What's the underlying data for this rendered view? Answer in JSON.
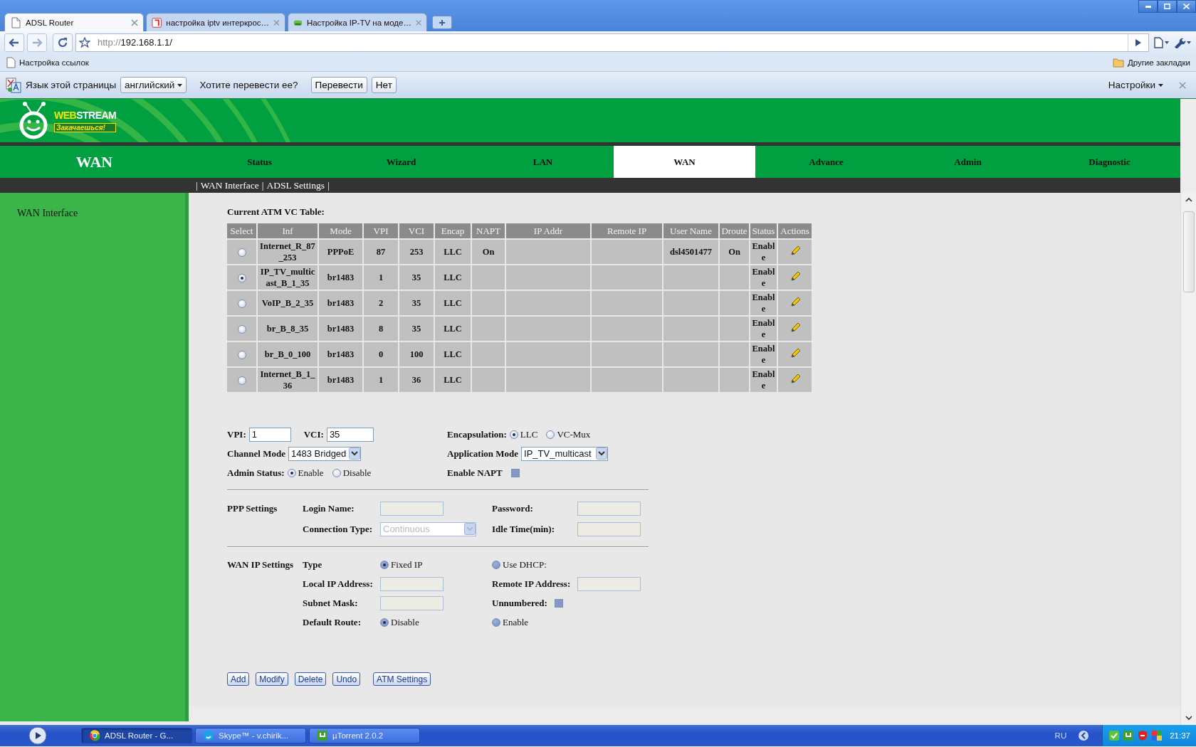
{
  "browser": {
    "tabs": [
      {
        "title": "ADSL Router",
        "selected": true
      },
      {
        "title": "настройка iptv интеркрос…",
        "selected": false
      },
      {
        "title": "Настройка IP-TV на моде…",
        "selected": false
      }
    ],
    "url": "http://192.168.1.1/",
    "bookmarks": [
      "Настройка ссылок"
    ],
    "other_bookmarks": "Другие закладки"
  },
  "translate_bar": {
    "label": "Язык этой страницы",
    "language": "английский",
    "question": "Хотите перевести ее?",
    "buttons": [
      "Перевести",
      "Нет"
    ],
    "settings": "Настройки"
  },
  "router": {
    "logo": {
      "brand_left": "WEB",
      "brand_right": "STREAM",
      "slogan": "Закачаешься!"
    },
    "section_title": "WAN",
    "nav": [
      {
        "label": "Status",
        "selected": false
      },
      {
        "label": "Wizard",
        "selected": false
      },
      {
        "label": "LAN",
        "selected": false
      },
      {
        "label": "WAN",
        "selected": true
      },
      {
        "label": "Advance",
        "selected": false
      },
      {
        "label": "Admin",
        "selected": false
      },
      {
        "label": "Diagnostic",
        "selected": false
      }
    ],
    "subnav": {
      "separator": "|",
      "links": [
        "WAN Interface",
        "ADSL Settings"
      ]
    },
    "sidebar": {
      "items": [
        "WAN Interface"
      ]
    }
  },
  "table": {
    "title": "Current ATM VC Table:",
    "columns": [
      "Select",
      "Inf",
      "Mode",
      "VPI",
      "VCI",
      "Encap",
      "NAPT",
      "IP Addr",
      "Remote IP",
      "User Name",
      "Droute",
      "Status",
      "Actions"
    ],
    "rows": [
      {
        "selected": false,
        "cells": [
          "",
          "Internet_R_87_253",
          "PPPoE",
          "87",
          "253",
          "LLC",
          "On",
          "",
          "",
          "dsl4501477",
          "On",
          "Enable",
          ""
        ]
      },
      {
        "selected": true,
        "cells": [
          "",
          "IP_TV_multicast_B_1_35",
          "br1483",
          "1",
          "35",
          "LLC",
          "",
          "",
          "",
          "",
          "",
          "Enable",
          ""
        ]
      },
      {
        "selected": false,
        "cells": [
          "",
          "VoIP_B_2_35",
          "br1483",
          "2",
          "35",
          "LLC",
          "",
          "",
          "",
          "",
          "",
          "Enable",
          ""
        ]
      },
      {
        "selected": false,
        "cells": [
          "",
          "br_B_8_35",
          "br1483",
          "8",
          "35",
          "LLC",
          "",
          "",
          "",
          "",
          "",
          "Enable",
          ""
        ]
      },
      {
        "selected": false,
        "cells": [
          "",
          "br_B_0_100",
          "br1483",
          "0",
          "100",
          "LLC",
          "",
          "",
          "",
          "",
          "",
          "Enable",
          ""
        ]
      },
      {
        "selected": false,
        "cells": [
          "",
          "Internet_B_1_36",
          "br1483",
          "1",
          "36",
          "LLC",
          "",
          "",
          "",
          "",
          "",
          "Enable",
          ""
        ]
      }
    ]
  },
  "form": {
    "vpi": {
      "label": "VPI:",
      "value": "1"
    },
    "vci": {
      "label": "VCI:",
      "value": "35"
    },
    "encapsulation": {
      "label": "Encapsulation:",
      "options": [
        {
          "label": "LLC",
          "selected": true,
          "disabled": false
        },
        {
          "label": "VC-Mux",
          "selected": false,
          "disabled": false
        }
      ]
    },
    "channel_mode": {
      "label": "Channel Mode",
      "value": "1483 Bridged"
    },
    "application_mode": {
      "label": "Application Mode",
      "value": "IP_TV_multicast"
    },
    "admin_status": {
      "label": "Admin Status:",
      "options": [
        {
          "label": "Enable",
          "selected": true,
          "disabled": false
        },
        {
          "label": "Disable",
          "selected": false,
          "disabled": false
        }
      ]
    },
    "enable_napt": {
      "label": "Enable NAPT",
      "checked": false,
      "disabled": true
    },
    "ppp_settings": {
      "title": "PPP Settings",
      "login_name": {
        "label": "Login Name:",
        "disabled": true
      },
      "password": {
        "label": "Password:",
        "disabled": true
      },
      "connection_type": {
        "label": "Connection Type:",
        "value": "Continuous",
        "disabled": true
      },
      "idle_time": {
        "label": "Idle Time(min):",
        "disabled": true
      }
    },
    "wan_ip_settings": {
      "title": "WAN IP Settings",
      "type": {
        "label": "Type",
        "options": [
          {
            "label": "Fixed IP",
            "selected": true,
            "disabled": true
          },
          {
            "label": "Use DHCP:",
            "selected": false,
            "disabled": true
          }
        ]
      },
      "local_ip": {
        "label": "Local IP Address:",
        "disabled": true
      },
      "remote_ip": {
        "label": "Remote IP Address:",
        "disabled": true
      },
      "subnet_mask": {
        "label": "Subnet Mask:",
        "disabled": true
      },
      "unnumbered": {
        "label": "Unnumbered:",
        "checked": false,
        "disabled": true
      },
      "default_route": {
        "label": "Default Route:",
        "options": [
          {
            "label": "Disable",
            "selected": true,
            "disabled": true
          },
          {
            "label": "Enable",
            "selected": false,
            "disabled": true
          }
        ]
      }
    },
    "buttons": [
      "Add",
      "Modify",
      "Delete",
      "Undo",
      "ATM Settings"
    ]
  },
  "taskbar": {
    "items": [
      {
        "label": "ADSL Router - G...",
        "selected": true
      },
      {
        "label": "Skype™ - v.chirik...",
        "selected": false
      },
      {
        "label": "µTorrent 2.0.2",
        "selected": false
      }
    ],
    "language": "RU",
    "clock": "21:37"
  }
}
